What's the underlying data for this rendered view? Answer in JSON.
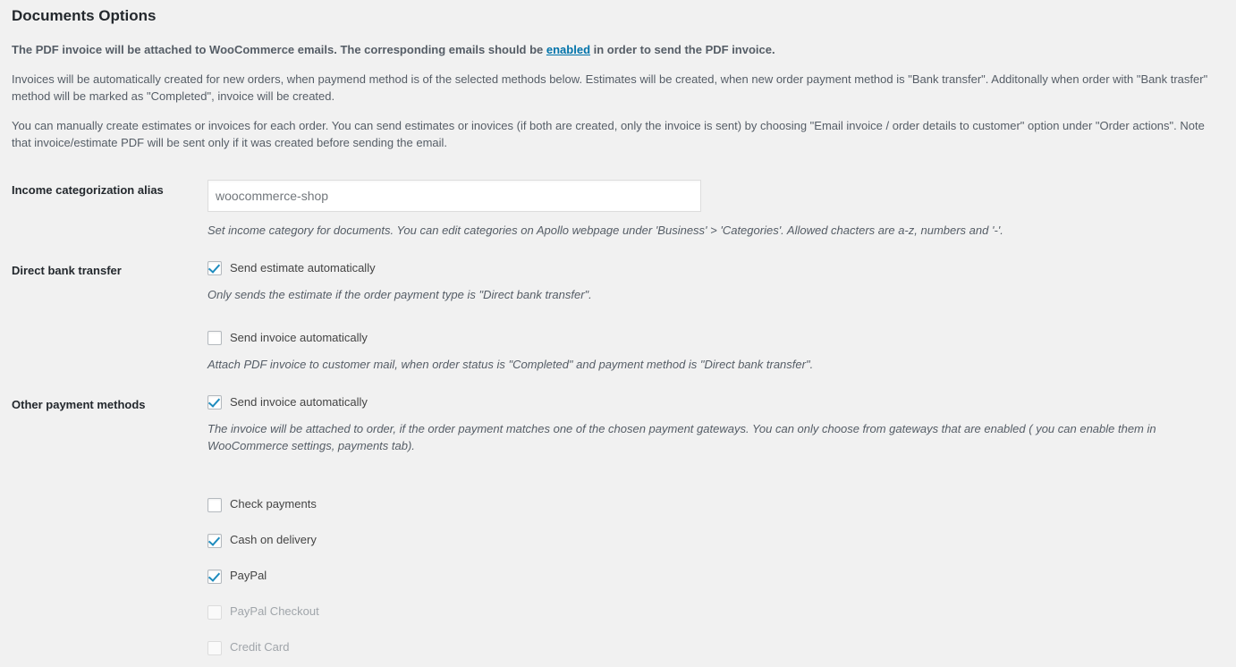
{
  "page": {
    "title": "Documents Options"
  },
  "intro": {
    "paragraph1_before": "The PDF invoice will be attached to WooCommerce emails. The corresponding emails should be ",
    "paragraph1_link": "enabled",
    "paragraph1_after": " in order to send the PDF invoice.",
    "paragraph2": "Invoices will be automatically created for new orders, when paymend method is of the selected methods below. Estimates will be created, when new order payment method is \"Bank transfer\". Additonally when order with \"Bank trasfer\" method will be marked as \"Completed\", invoice will be created.",
    "paragraph3": "You can manually create estimates or invoices for each order. You can send estimates or inovices (if both are created, only the invoice is sent) by choosing \"Email invoice / order details to customer\" option under \"Order actions\". Note that invoice/estimate PDF will be sent only if it was created before sending the email."
  },
  "fields": {
    "income_alias": {
      "label": "Income categorization alias",
      "value": "",
      "placeholder": "woocommerce-shop",
      "description": "Set income category for documents. You can edit categories on Apollo webpage under 'Business' > 'Categories'. Allowed chacters are a-z, numbers and '-'."
    },
    "direct_bank_transfer": {
      "label": "Direct bank transfer",
      "options": [
        {
          "label": "Send estimate automatically",
          "checked": true,
          "disabled": false,
          "description": "Only sends the estimate if the order payment type is \"Direct bank transfer\"."
        },
        {
          "label": "Send invoice automatically",
          "checked": false,
          "disabled": false,
          "description": "Attach PDF invoice to customer mail, when order status is \"Completed\" and payment method is \"Direct bank transfer\"."
        }
      ]
    },
    "other_payment_methods": {
      "label": "Other payment methods",
      "main_option": {
        "label": "Send invoice automatically",
        "checked": true,
        "disabled": false,
        "description": "The invoice will be attached to order, if the order payment matches one of the chosen payment gateways. You can only choose from gateways that are enabled ( you can enable them in WooCommerce settings, payments tab)."
      },
      "gateways": [
        {
          "label": "Check payments",
          "checked": false,
          "disabled": false
        },
        {
          "label": "Cash on delivery",
          "checked": true,
          "disabled": false
        },
        {
          "label": "PayPal",
          "checked": true,
          "disabled": false
        },
        {
          "label": "PayPal Checkout",
          "checked": false,
          "disabled": true
        },
        {
          "label": "Credit Card",
          "checked": false,
          "disabled": true
        }
      ]
    }
  },
  "colors": {
    "background": "#f1f1f1",
    "link": "#0073aa",
    "checkmark": "#1e8cbe",
    "heading": "#23282d",
    "text": "#555d66"
  }
}
